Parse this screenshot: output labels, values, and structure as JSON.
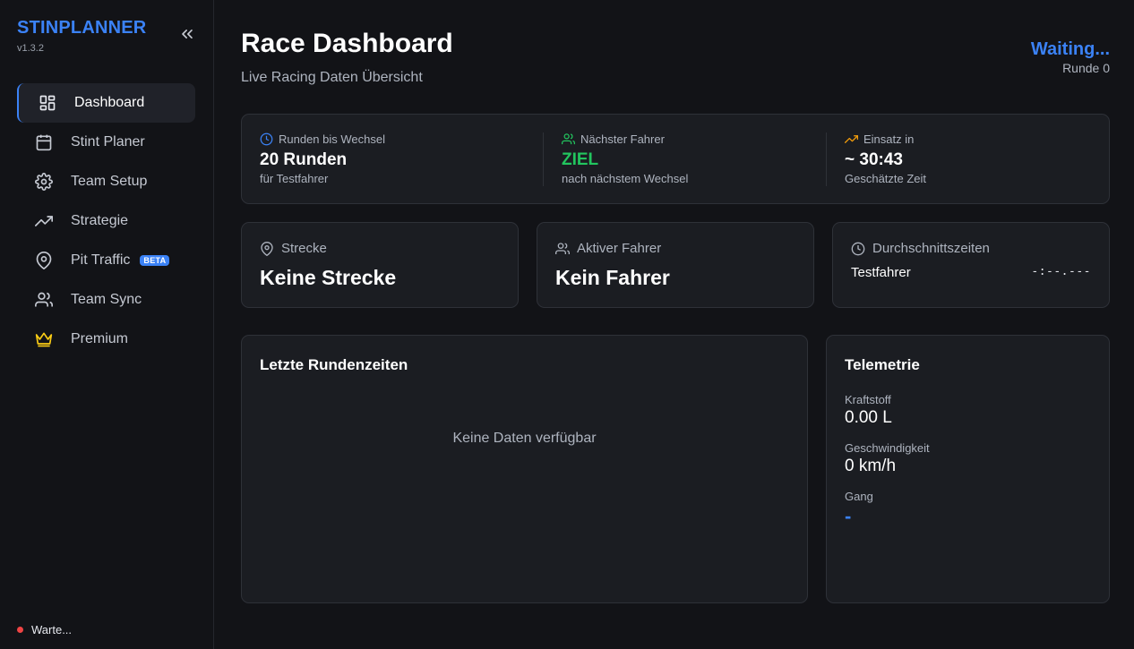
{
  "sidebar": {
    "brand": "STINPLANNER",
    "version": "v1.3.2",
    "items": [
      {
        "label": "Dashboard",
        "icon": "dashboard-grid-icon"
      },
      {
        "label": "Stint Planer",
        "icon": "calendar-icon"
      },
      {
        "label": "Team Setup",
        "icon": "gear-icon"
      },
      {
        "label": "Strategie",
        "icon": "trending-up-icon"
      },
      {
        "label": "Pit Traffic",
        "icon": "map-pin-icon",
        "badge": "BETA"
      },
      {
        "label": "Team Sync",
        "icon": "users-icon"
      },
      {
        "label": "Premium",
        "icon": "crown-icon"
      }
    ],
    "status": "Warte..."
  },
  "header": {
    "title": "Race Dashboard",
    "subtitle": "Live Racing Daten Übersicht",
    "state": "Waiting...",
    "round": "Runde 0"
  },
  "info": {
    "laps_until_change": {
      "label": "Runden bis Wechsel",
      "value": "20 Runden",
      "sub": "für Testfahrer"
    },
    "next_driver": {
      "label": "Nächster Fahrer",
      "value": "ZIEL",
      "sub": "nach nächstem Wechsel"
    },
    "stint_in": {
      "label": "Einsatz in",
      "value": "~ 30:43",
      "sub": "Geschätzte Zeit"
    }
  },
  "stats": {
    "track": {
      "label": "Strecke",
      "value": "Keine Strecke"
    },
    "driver": {
      "label": "Aktiver Fahrer",
      "value": "Kein Fahrer"
    },
    "averages": {
      "label": "Durchschnittszeiten",
      "driver": "Testfahrer",
      "time": "-:--.---"
    }
  },
  "laps": {
    "title": "Letzte Rundenzeiten",
    "empty": "Keine Daten verfügbar"
  },
  "telemetry": {
    "title": "Telemetrie",
    "fuel_label": "Kraftstoff",
    "fuel": "0.00 L",
    "speed_label": "Geschwindigkeit",
    "speed": "0 km/h",
    "gear_label": "Gang",
    "gear": "-"
  },
  "colors": {
    "accent": "#3b82f6",
    "success": "#22c55e",
    "warning": "#f59e0b",
    "premium": "#facc15",
    "status_dot": "#ef4444"
  }
}
